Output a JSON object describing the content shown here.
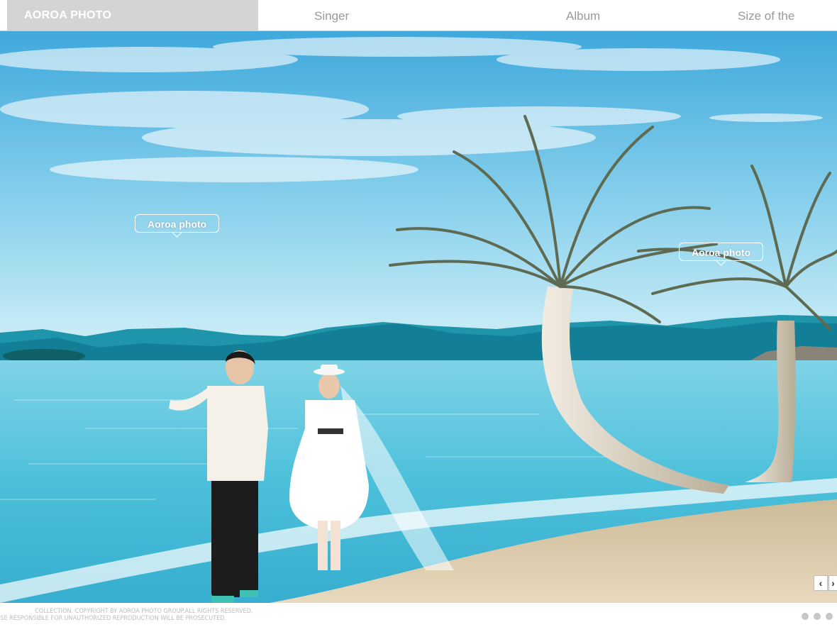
{
  "brand": {
    "name": "AOROA PHOTO"
  },
  "nav": {
    "items": [
      {
        "label": "Singer"
      },
      {
        "label": "Album"
      },
      {
        "label": "Size of the"
      }
    ]
  },
  "hero": {
    "tags": [
      "Aoroa photo",
      "Aoroa photo"
    ],
    "prev_label": "‹",
    "next_label": "›"
  },
  "footer": {
    "copyright_line1": "COLLECTION. COPYRIGHT BY AOROA PHOTO GROUP.ALL RIGHTS RESERVED.",
    "copyright_line2": "OSE RESPONSIBLE FOR UNAUTHORIZED REPRODUCTION WILL BE PROSECUTED.",
    "slide_count": 3
  },
  "colors": {
    "brand_bg": "#d4d4d4",
    "nav_text": "#9a9a9a",
    "sky": "#6cc3e8",
    "sea": "#4fc3dc",
    "sand": "#e4d4b6"
  }
}
